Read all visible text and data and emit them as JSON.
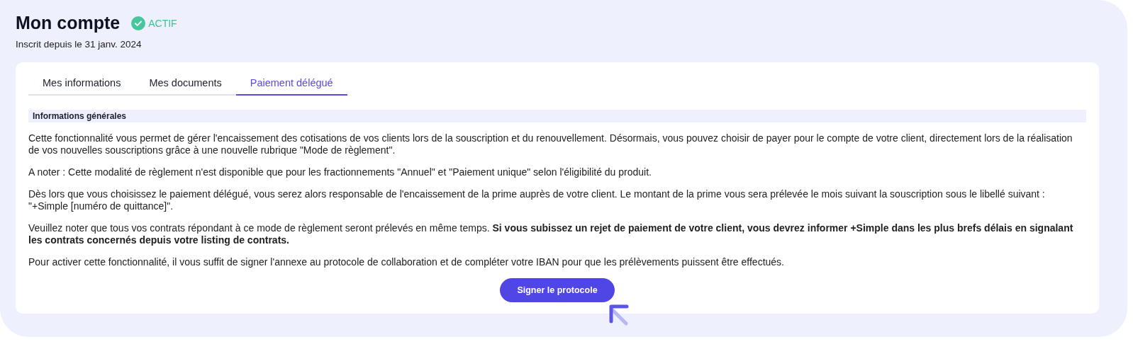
{
  "header": {
    "title": "Mon compte",
    "status": {
      "label": "ACTIF",
      "active": true
    },
    "subtitle": "Inscrit depuis le 31 janv. 2024"
  },
  "tabs": [
    {
      "label": "Mes informations",
      "selected": false
    },
    {
      "label": "Mes documents",
      "selected": false
    },
    {
      "label": "Paiement délégué",
      "selected": true
    }
  ],
  "section": {
    "title": "Informations générales",
    "paragraphs": [
      "Cette fonctionnalité vous permet de gérer l'encaissement des cotisations de vos clients lors de la souscription et du renouvellement. Désormais, vous pouvez choisir de payer pour le compte de votre client, directement lors de la réalisation de vos nouvelles souscriptions grâce à une nouvelle rubrique \"Mode de règlement\".",
      "A noter : Cette modalité de règlement n'est disponible que pour les fractionnements \"Annuel\" et \"Paiement unique\" selon l'éligibilité du produit.",
      "Dès lors que vous choisissez le paiement délégué, vous serez alors responsable de l'encaissement de la prime auprès de votre client. Le montant de la prime vous sera prélevée le mois suivant la souscription sous le libellé suivant : \"+Simple [numéro de quittance]\".",
      "Veuillez noter que tous vos contrats répondant à ce mode de règlement seront prélevés en même temps. **Si vous subissez un rejet de paiement de votre client, vous devrez informer +Simple dans les plus brefs délais en signalant les contrats concernés depuis votre listing de contrats.**",
      "Pour activer cette fonctionnalité, il vous suffit de signer l'annexe au protocole de collaboration et de compléter votre IBAN pour que les prélèvements puissent être effectués."
    ],
    "button": "Signer le protocole"
  }
}
